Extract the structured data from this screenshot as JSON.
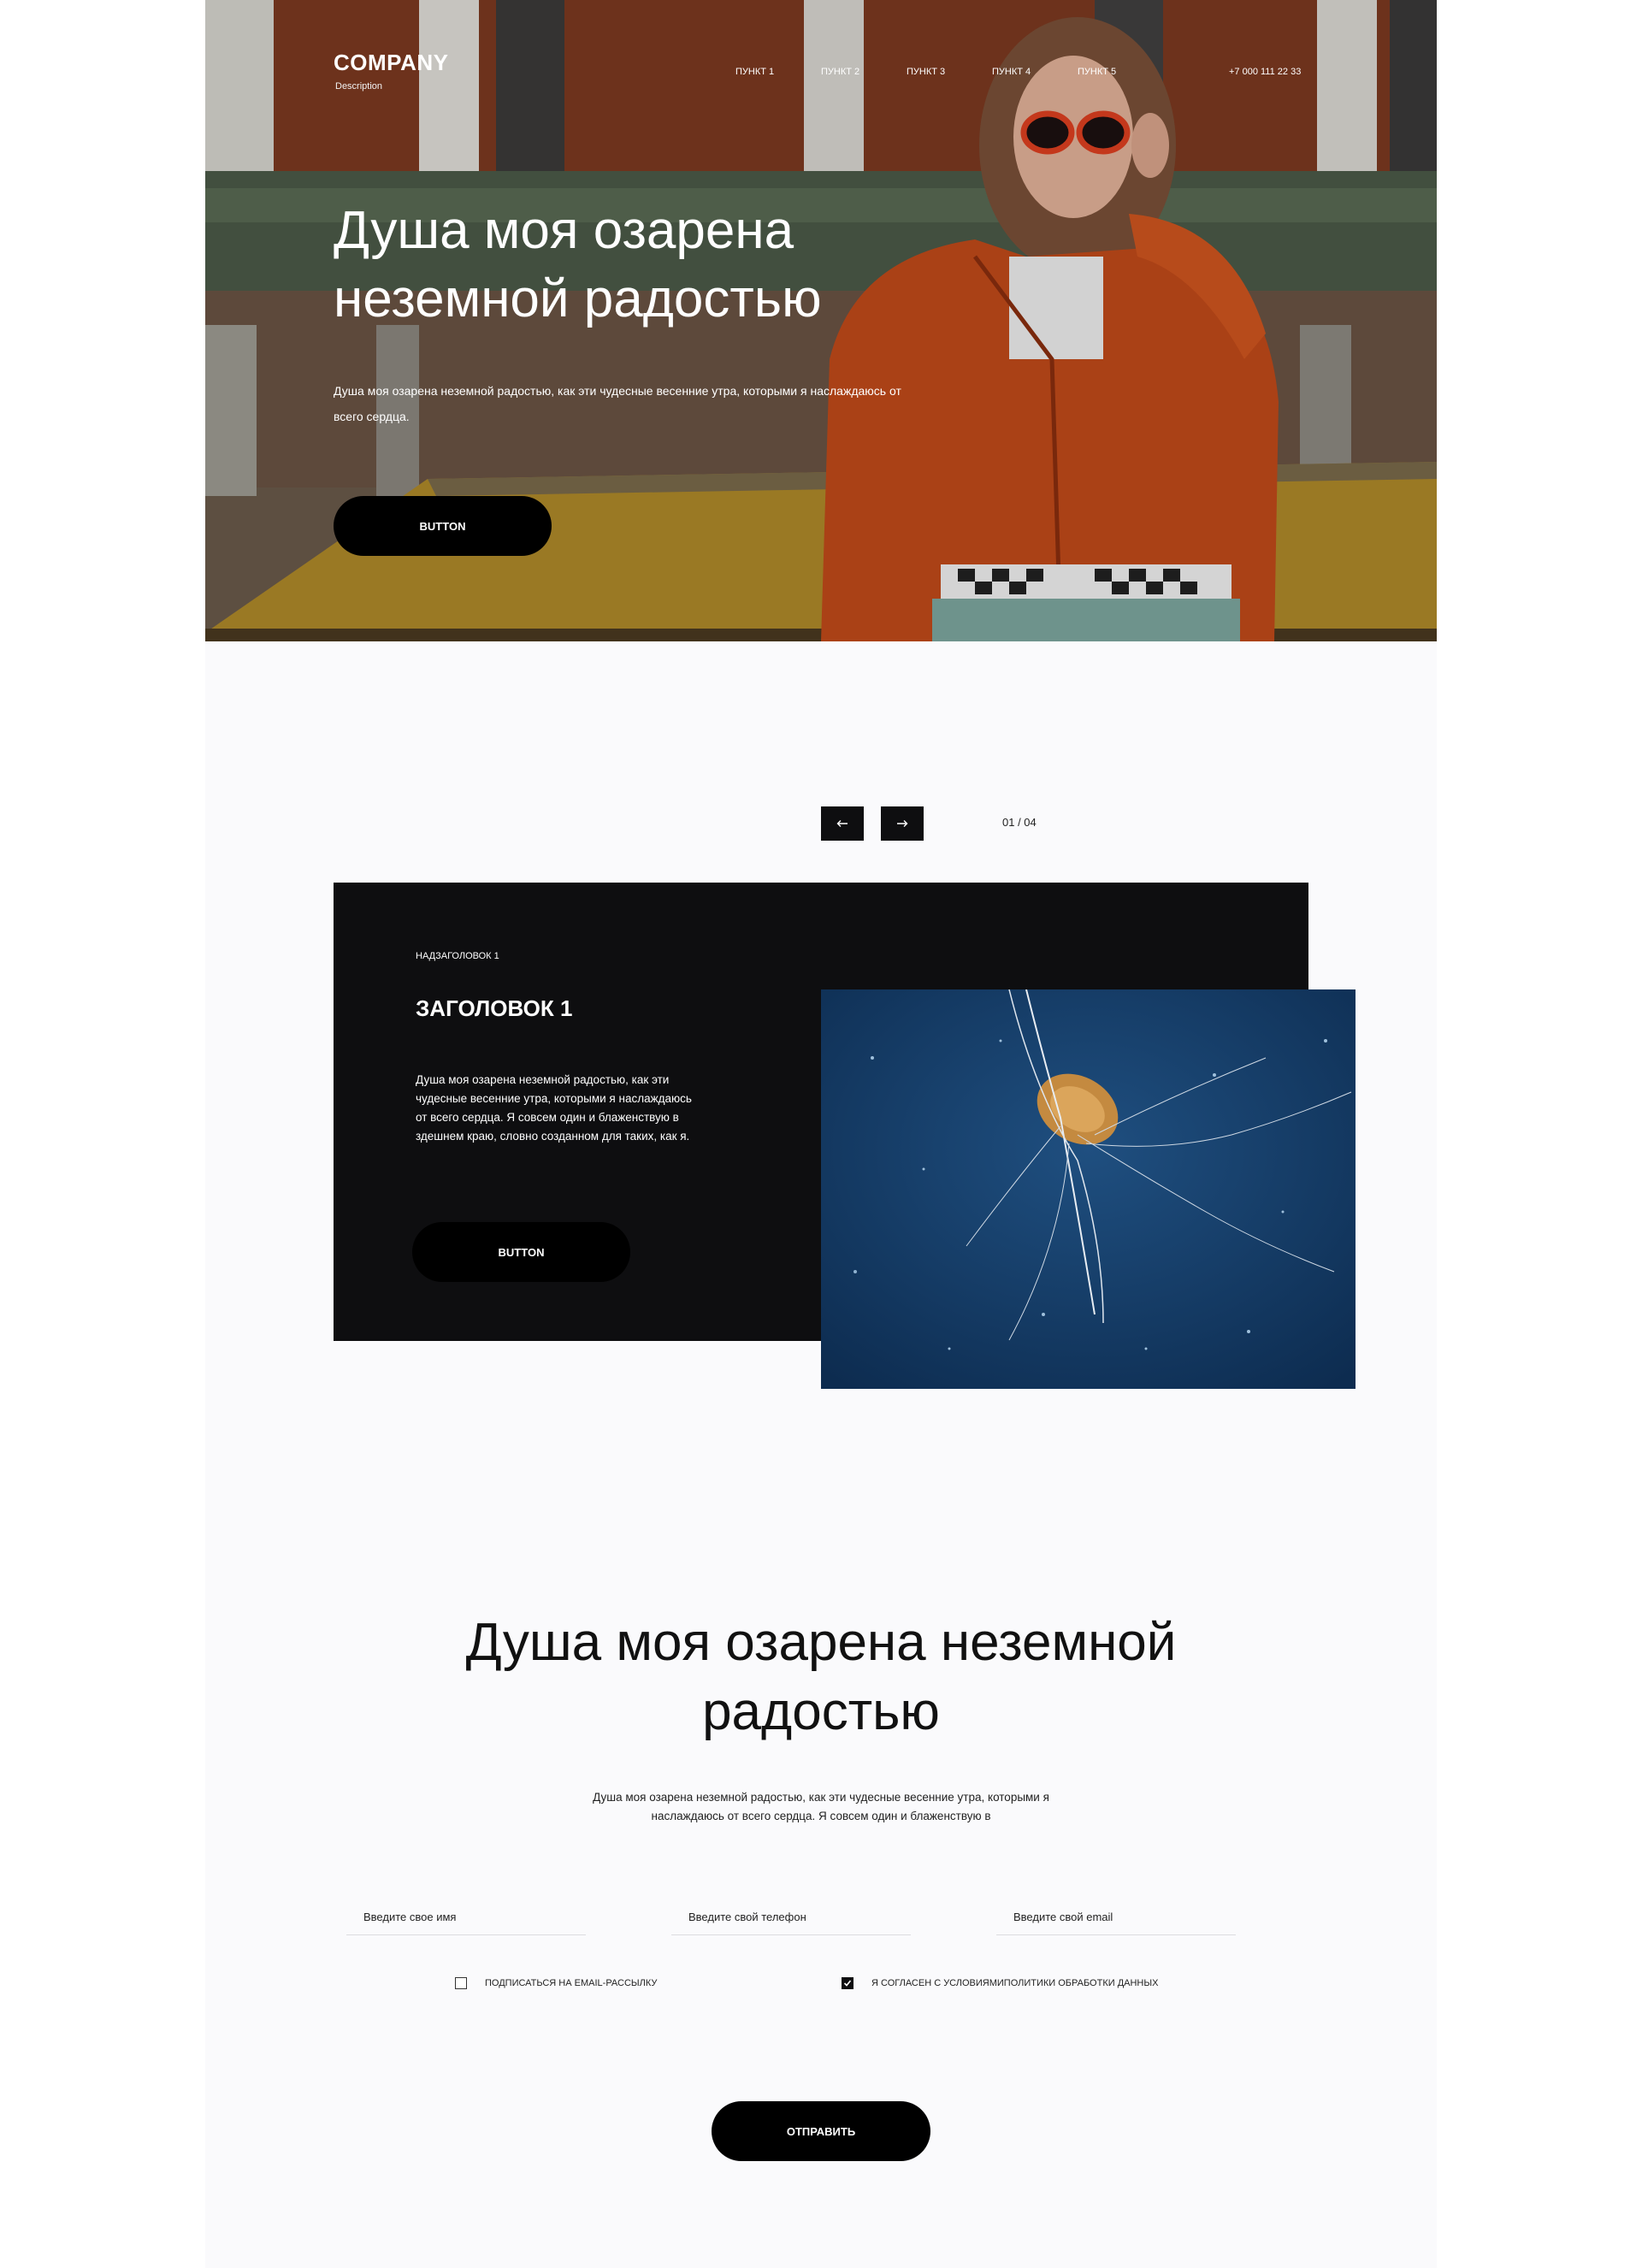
{
  "header": {
    "logo": "COMPANY",
    "description": "Description",
    "nav": [
      "ПУНКТ 1",
      "ПУНКТ 2",
      "ПУНКТ 3",
      "ПУНКТ 4",
      "ПУНКТ 5"
    ],
    "phone": "+7 000 111 22 33"
  },
  "hero": {
    "title": "Душа моя озарена неземной радостью",
    "text": "Душа моя озарена неземной радостью, как эти чудесные весенние утра, которыми я наслаждаюсь от всего сердца.",
    "button": "BUTTON"
  },
  "slider": {
    "counter": "01 / 04",
    "card": {
      "eyebrow": "НАДЗАГОЛОВОК 1",
      "title": "ЗАГОЛОВОК 1",
      "text": "Душа моя озарена неземной радостью, как эти чудесные весенние утра, которыми я наслаждаюсь от всего сердца. Я совсем один и блаженствую в здешнем краю, словно созданном для таких, как я.",
      "button": "BUTTON"
    }
  },
  "form": {
    "title": "Душа моя озарена неземной радостью",
    "text": "Душа моя озарена неземной радостью, как эти чудесные весенние утра, которыми я наслаждаюсь от всего сердца. Я совсем один и блаженствую в",
    "name_placeholder": "Введите свое имя",
    "phone_placeholder": "Введите свой телефон",
    "email_placeholder": "Введите свой email",
    "subscribe_label": "ПОДПИСАТЬСЯ НА EMAIL-РАССЫЛКУ",
    "subscribe_checked": false,
    "agree_label": "Я СОГЛАСЕН С УСЛОВИЯМИПОЛИТИКИ ОБРАБОТКИ ДАННЫХ",
    "agree_checked": true,
    "submit": "ОТПРАВИТЬ"
  },
  "icons": {
    "prev": "arrow-left-icon",
    "next": "arrow-right-icon",
    "check": "checkmark-icon"
  }
}
